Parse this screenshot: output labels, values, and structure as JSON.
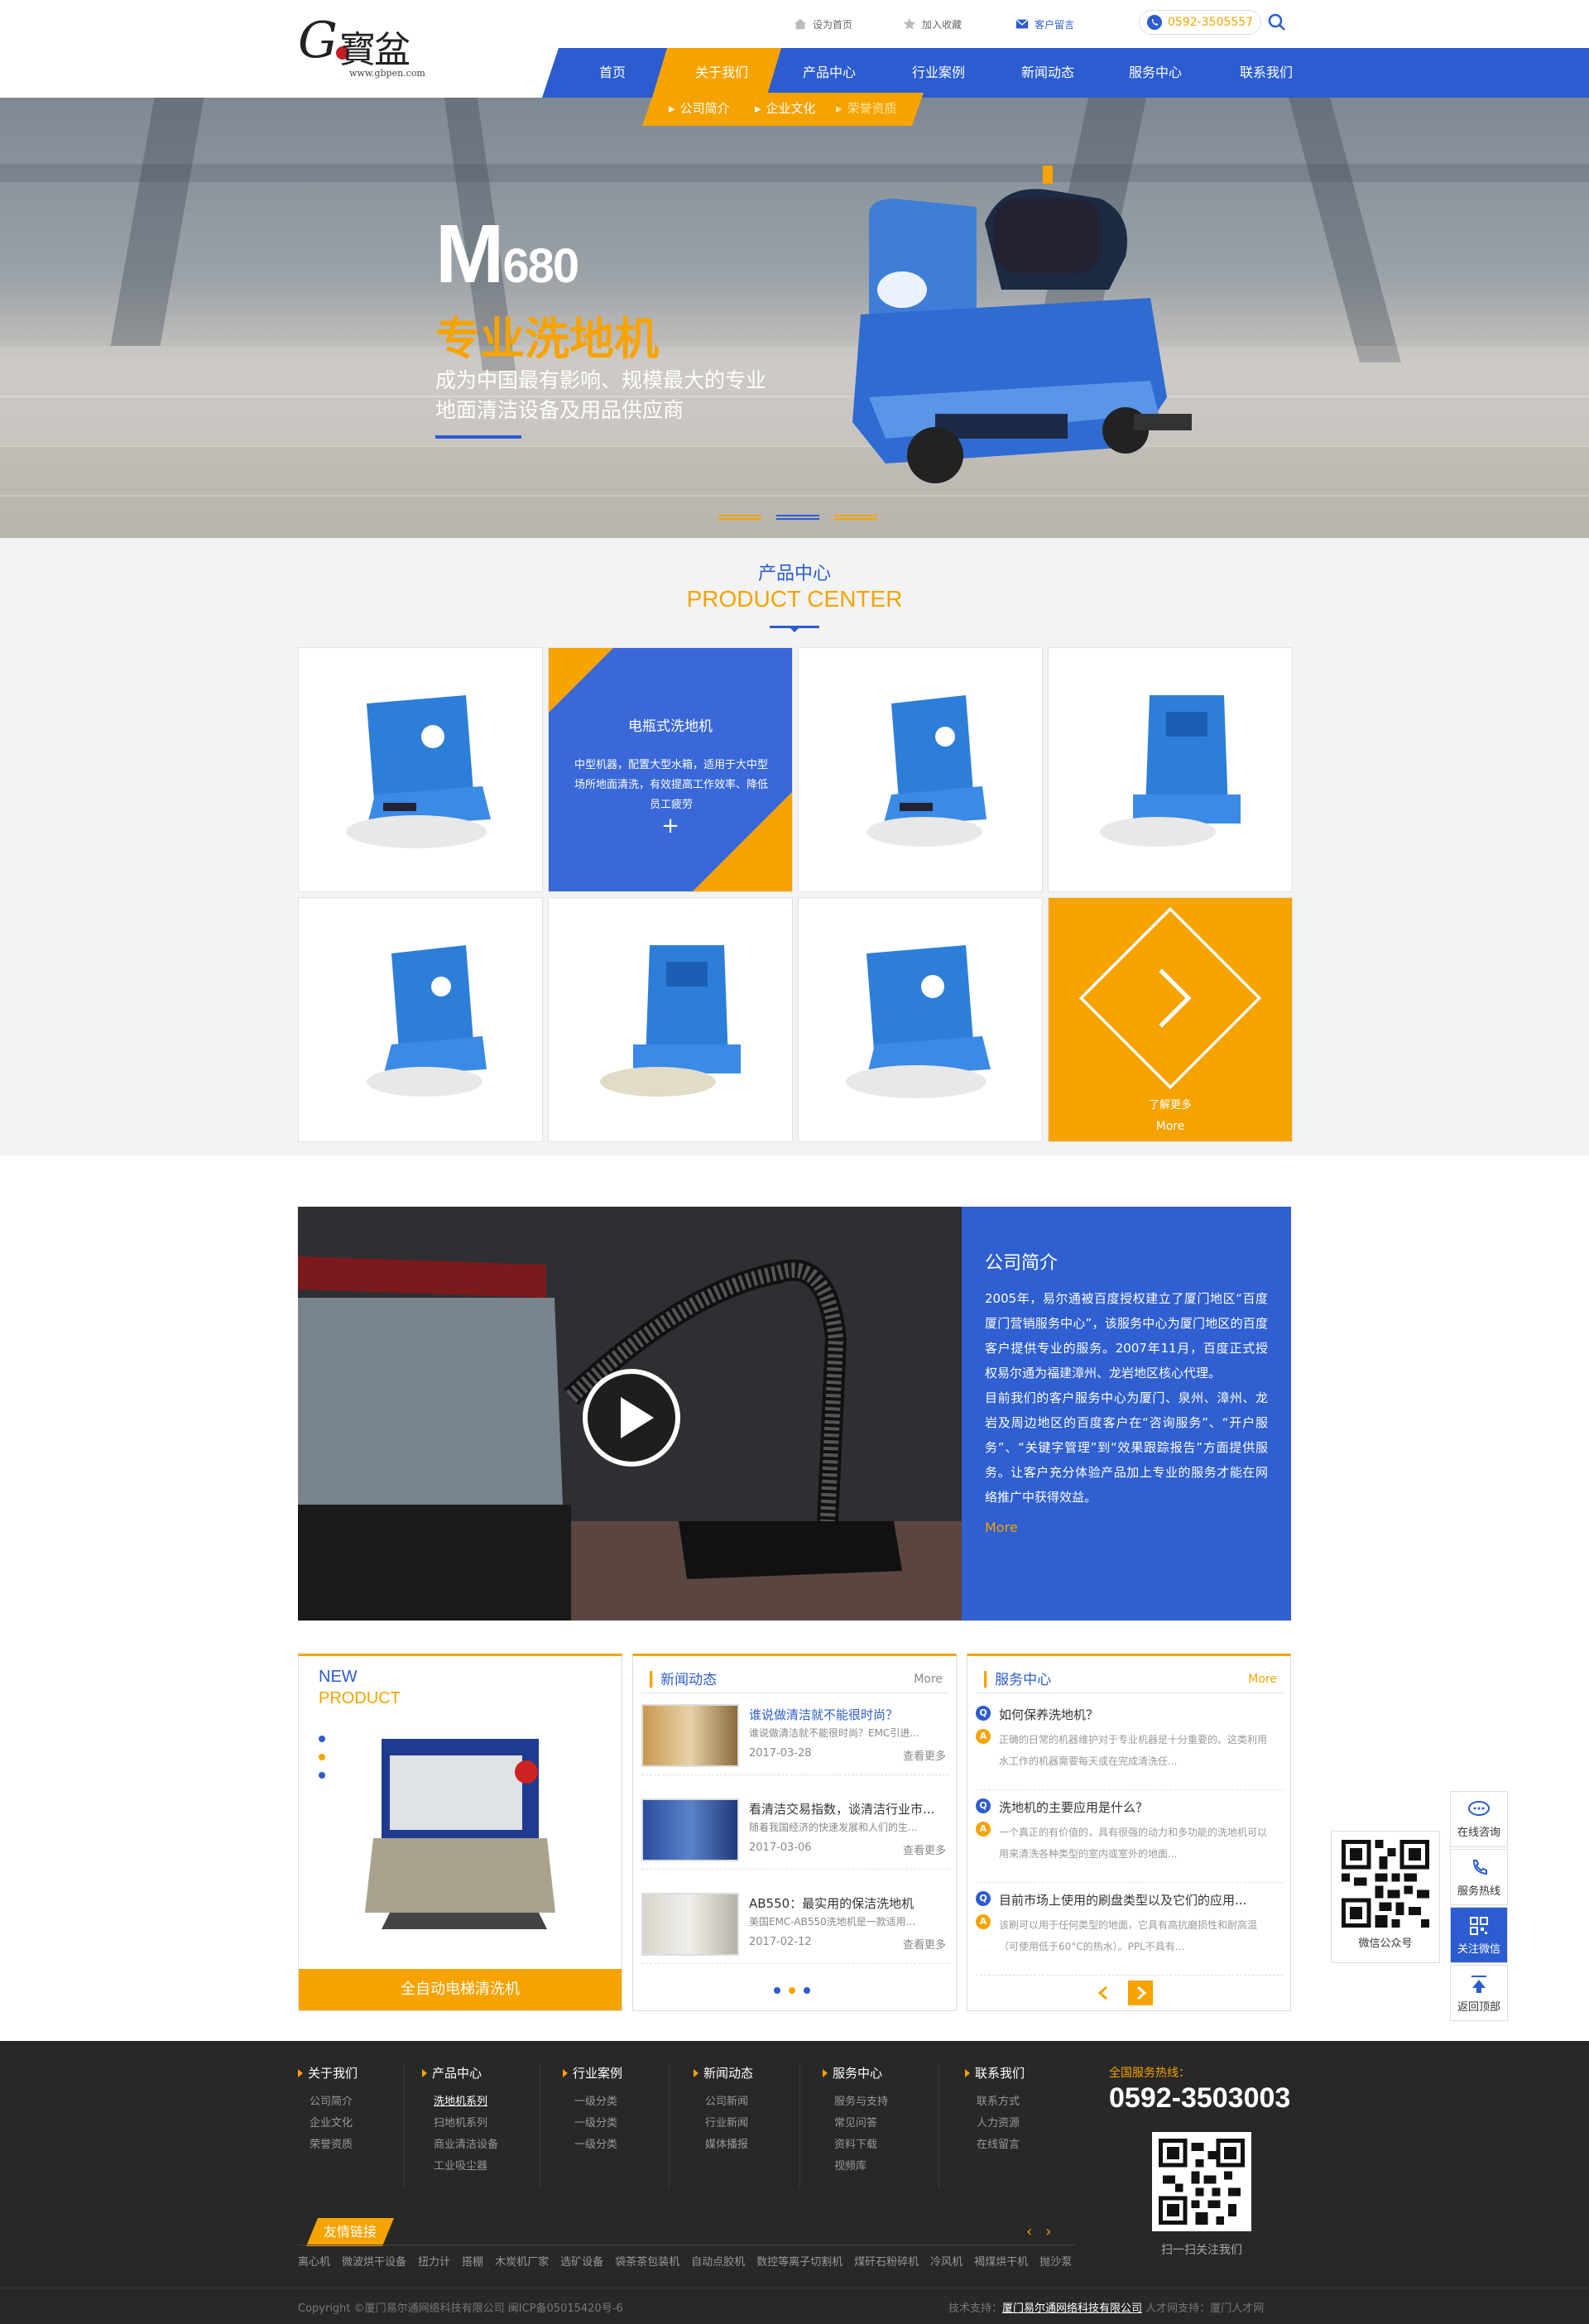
{
  "header": {
    "logo_text": "G寳盆",
    "logo_url": "www.gbpen.com",
    "top_links": [
      "设为首页",
      "加入收藏",
      "客户留言"
    ],
    "phone": "0592-3505557",
    "nav": [
      "首页",
      "关于我们",
      "产品中心",
      "行业案例",
      "新闻动态",
      "服务中心",
      "联系我们"
    ],
    "active_nav": "关于我们",
    "subnav": [
      "公司简介",
      "企业文化",
      "荣誉资质"
    ]
  },
  "banner": {
    "model_big": "M",
    "model_num": "680",
    "headline": "专业洗地机",
    "desc_line1": "成为中国最有影响、规模最大的专业",
    "desc_line2": "地面清洁设备及用品供应商",
    "slide_count": 3,
    "active_slide": 2
  },
  "product_center": {
    "title_cn": "产品中心",
    "title_en": "PRODUCT CENTER",
    "hover_card": {
      "title": "电瓶式洗地机",
      "desc": "中型机器，配置大型水箱，适用于大中型场所地面清洗，有效提高工作效率、降低员工疲劳",
      "plus": "+"
    },
    "more_card": {
      "label_cn": "了解更多",
      "label_en": "More"
    }
  },
  "about": {
    "title": "公司简介",
    "para1": "2005年，易尔通被百度授权建立了厦门地区“百度厦门营销服务中心”，该服务中心为厦门地区的百度客户提供专业的服务。2007年11月，百度正式授权易尔通为福建漳州、龙岩地区核心代理。",
    "para2": "目前我们的客户服务中心为厦门、泉州、漳州、龙岩及周边地区的百度客户在“咨询服务”、“开户服务”、“关键字管理”到“效果跟踪报告”方面提供服务。让客户充分体验产品加上专业的服务才能在网络推广中获得效益。",
    "more": "More"
  },
  "new_product": {
    "tag1": "NEW",
    "tag2": "PRODUCT",
    "caption": "全自动电梯清洗机"
  },
  "news": {
    "title": "新闻动态",
    "more": "More",
    "items": [
      {
        "title": "谁说做清洁就不能很时尚？",
        "desc": "谁说做清洁就不能很时尚？EMC引进...",
        "date": "2017-03-28",
        "more": "查看更多"
      },
      {
        "title": "看清洁交易指数，谈清洁行业市...",
        "desc": "随着我国经济的快速发展和人们的生...",
        "date": "2017-03-06",
        "more": "查看更多"
      },
      {
        "title": "AB550：最实用的保洁洗地机",
        "desc": "美国EMC-AB550洗地机是一款适用...",
        "date": "2017-02-12",
        "more": "查看更多"
      }
    ]
  },
  "service": {
    "title": "服务中心",
    "more": "More",
    "items": [
      {
        "q": "如何保养洗地机？",
        "a": "正确的日常的机器维护对于专业机器是十分重要的。这类利用水工作的机器需要每天或在完成清洗任..."
      },
      {
        "q": "洗地机的主要应用是什么？",
        "a": "一个真正的有价值的，具有很强的动力和多功能的洗地机可以用来清洗各种类型的室内或室外的地面..."
      },
      {
        "q": "目前市场上使用的刷盘类型以及它们的应用...",
        "a": "该刷可以用于任何类型的地面，它具有高抗磨损性和耐高温（可使用低于60°C的热水）。PPL不具有..."
      }
    ],
    "q_badge": "Q",
    "a_badge": "A"
  },
  "sidebar": {
    "buttons": [
      "在线咨询",
      "服务热线",
      "关注微信",
      "返回顶部"
    ],
    "qr_label": "微信公众号"
  },
  "footer": {
    "cols": [
      {
        "head": "关于我们",
        "items": [
          "公司简介",
          "企业文化",
          "荣誉资质"
        ]
      },
      {
        "head": "产品中心",
        "items": [
          "洗地机系列",
          "扫地机系列",
          "商业清洁设备",
          "工业吸尘器"
        ]
      },
      {
        "head": "行业案例",
        "items": [
          "一级分类",
          "一级分类",
          "一级分类"
        ]
      },
      {
        "head": "新闻动态",
        "items": [
          "公司新闻",
          "行业新闻",
          "媒体播报"
        ]
      },
      {
        "head": "服务中心",
        "items": [
          "服务与支持",
          "常见问答",
          "资料下载",
          "视频库"
        ]
      },
      {
        "head": "联系我们",
        "items": [
          "联系方式",
          "人力资源",
          "在线留言"
        ]
      }
    ],
    "hotline_label": "全国服务热线：",
    "hotline": "0592-3503003",
    "qr_label": "扫一扫关注我们",
    "friend_label": "友情链接",
    "friend_links": [
      "离心机",
      "微波烘干设备",
      "扭力计",
      "搭棚",
      "木炭机厂家",
      "选矿设备",
      "袋茶茶包装机",
      "自动点胶机",
      "数控等离子切割机",
      "煤矸石粉碎机",
      "冷风机",
      "褐煤烘干机",
      "抛沙泵"
    ],
    "copyright": "Copyright ©厦门易尔通网络科技有限公司  闽ICP备05015420号-6",
    "tech_label": "技术支持：",
    "tech_company": "厦门易尔通网络科技有限公司",
    "talent_label": "人才网支持：",
    "talent": "厦门人才网"
  },
  "colors": {
    "blue": "#2c5ccf",
    "orange": "#f6a300",
    "footer_bg": "#282828"
  }
}
